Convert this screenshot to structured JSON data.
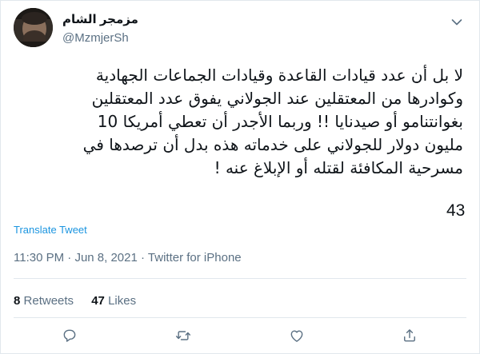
{
  "author": {
    "display_name": "مزمجر الشام",
    "handle": "@MzmjerSh"
  },
  "tweet": {
    "lines": [
      "لا بل أن عدد قيادات القاعدة وقيادات الجماعات الجهادية",
      "وكوادرها من المعتقلين عند الجولاني يفوق عدد المعتقلين",
      "بغوانتنامو أو صيدنايا !! وربما الأجدر  أن تعطي أمريكا 10",
      "مليون دولار للجولاني على خدماته هذه بدل  أن ترصدها في",
      "مسرحية المكافئة لقتله أو الإبلاغ عنه !"
    ],
    "extra_number": "43",
    "translate_label": "Translate Tweet"
  },
  "meta": {
    "time": "11:30 PM",
    "separator1": " · ",
    "date": "Jun 8, 2021",
    "separator2": " · ",
    "source": "Twitter for iPhone"
  },
  "stats": {
    "retweets_count": "8",
    "retweets_label": "Retweets",
    "likes_count": "47",
    "likes_label": "Likes"
  },
  "actions": {
    "reply_icon": "reply-icon",
    "retweet_icon": "retweet-icon",
    "like_icon": "like-icon",
    "share_icon": "share-icon"
  },
  "colors": {
    "text": "#0f1419",
    "secondary": "#5b7083",
    "link": "#1b95e0",
    "border": "#e1e8ed"
  }
}
